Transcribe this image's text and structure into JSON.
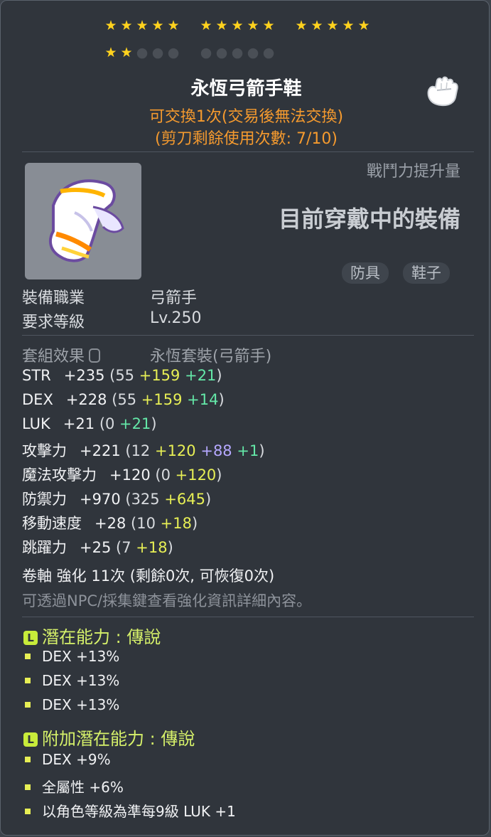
{
  "stars": {
    "earned": 17,
    "total": 25
  },
  "item": {
    "name": "永恆弓箭手鞋",
    "trade_note": "可交換1次(交易後無法交換)",
    "scissor_note": "(剪刀剩餘使用次數: 7/10)",
    "power_label": "戰鬥力提升量",
    "equipped_label": "目前穿戴中的裝備",
    "tags": [
      "防具",
      "鞋子"
    ]
  },
  "requirements": [
    {
      "key": "裝備職業",
      "value": "弓箭手"
    },
    {
      "key": "要求等級",
      "value": "Lv.250"
    }
  ],
  "set_effect": {
    "key": "套組效果",
    "value": "永恆套裝(弓箭手)"
  },
  "stats": [
    {
      "name": "STR",
      "total": "+235",
      "parts": [
        {
          "text": "(55 ",
          "c": "gy"
        },
        {
          "text": "+159",
          "c": "yl"
        },
        {
          "text": " ",
          "c": "gy"
        },
        {
          "text": "+21",
          "c": "gn"
        },
        {
          "text": ")",
          "c": "gy"
        }
      ]
    },
    {
      "name": "DEX",
      "total": "+228",
      "parts": [
        {
          "text": "(55 ",
          "c": "gy"
        },
        {
          "text": "+159",
          "c": "yl"
        },
        {
          "text": " ",
          "c": "gy"
        },
        {
          "text": "+14",
          "c": "gn"
        },
        {
          "text": ")",
          "c": "gy"
        }
      ]
    },
    {
      "name": "LUK",
      "total": "+21",
      "parts": [
        {
          "text": "(0 ",
          "c": "gy"
        },
        {
          "text": "+21",
          "c": "gn"
        },
        {
          "text": ")",
          "c": "gy"
        }
      ]
    },
    {
      "name": "攻擊力",
      "total": "+221",
      "parts": [
        {
          "text": "(12 ",
          "c": "gy"
        },
        {
          "text": "+120",
          "c": "yl"
        },
        {
          "text": " ",
          "c": "gy"
        },
        {
          "text": "+88",
          "c": "pr"
        },
        {
          "text": " ",
          "c": "gy"
        },
        {
          "text": "+1",
          "c": "gn"
        },
        {
          "text": ")",
          "c": "gy"
        }
      ]
    },
    {
      "name": "魔法攻擊力",
      "total": "+120",
      "parts": [
        {
          "text": "(0 ",
          "c": "gy"
        },
        {
          "text": "+120",
          "c": "yl"
        },
        {
          "text": ")",
          "c": "gy"
        }
      ]
    },
    {
      "name": "防禦力",
      "total": "+970",
      "parts": [
        {
          "text": "(325 ",
          "c": "gy"
        },
        {
          "text": "+645",
          "c": "yl"
        },
        {
          "text": ")",
          "c": "gy"
        }
      ]
    },
    {
      "name": "移動速度",
      "total": "+28",
      "parts": [
        {
          "text": "(10 ",
          "c": "gy"
        },
        {
          "text": "+18",
          "c": "yl"
        },
        {
          "text": ")",
          "c": "gy"
        }
      ]
    },
    {
      "name": "跳躍力",
      "total": "+25",
      "parts": [
        {
          "text": "(7 ",
          "c": "gy"
        },
        {
          "text": "+18",
          "c": "yl"
        },
        {
          "text": ")",
          "c": "gy"
        }
      ]
    }
  ],
  "scroll": {
    "line": "卷軸 強化 11次 (剩餘0次, 可恢復0次)",
    "npc_note": "可透過NPC/採集鍵查看強化資訊詳細內容。"
  },
  "potential": {
    "badge": "L",
    "title": "潛在能力 : 傳說",
    "lines": [
      "DEX +13%",
      "DEX +13%",
      "DEX +13%"
    ]
  },
  "bonus_potential": {
    "badge": "L",
    "title": "附加潛在能力 : 傳說",
    "lines": [
      "DEX +9%",
      "全屬性 +6%",
      "以角色等級為準每9級 LUK +1"
    ]
  },
  "colors": {
    "star_on": "#ffd21e",
    "star_off": "#4a4f56",
    "orange": "#f59a2e",
    "yellow_bonus": "#e7ef55",
    "green_bonus": "#64e8a8",
    "purple_bonus": "#b5a8ff",
    "legend_green": "#d6f16a"
  },
  "icons": [
    "glove-icon",
    "item-shoe-icon",
    "lock-icon",
    "legendary-badge-icon"
  ]
}
